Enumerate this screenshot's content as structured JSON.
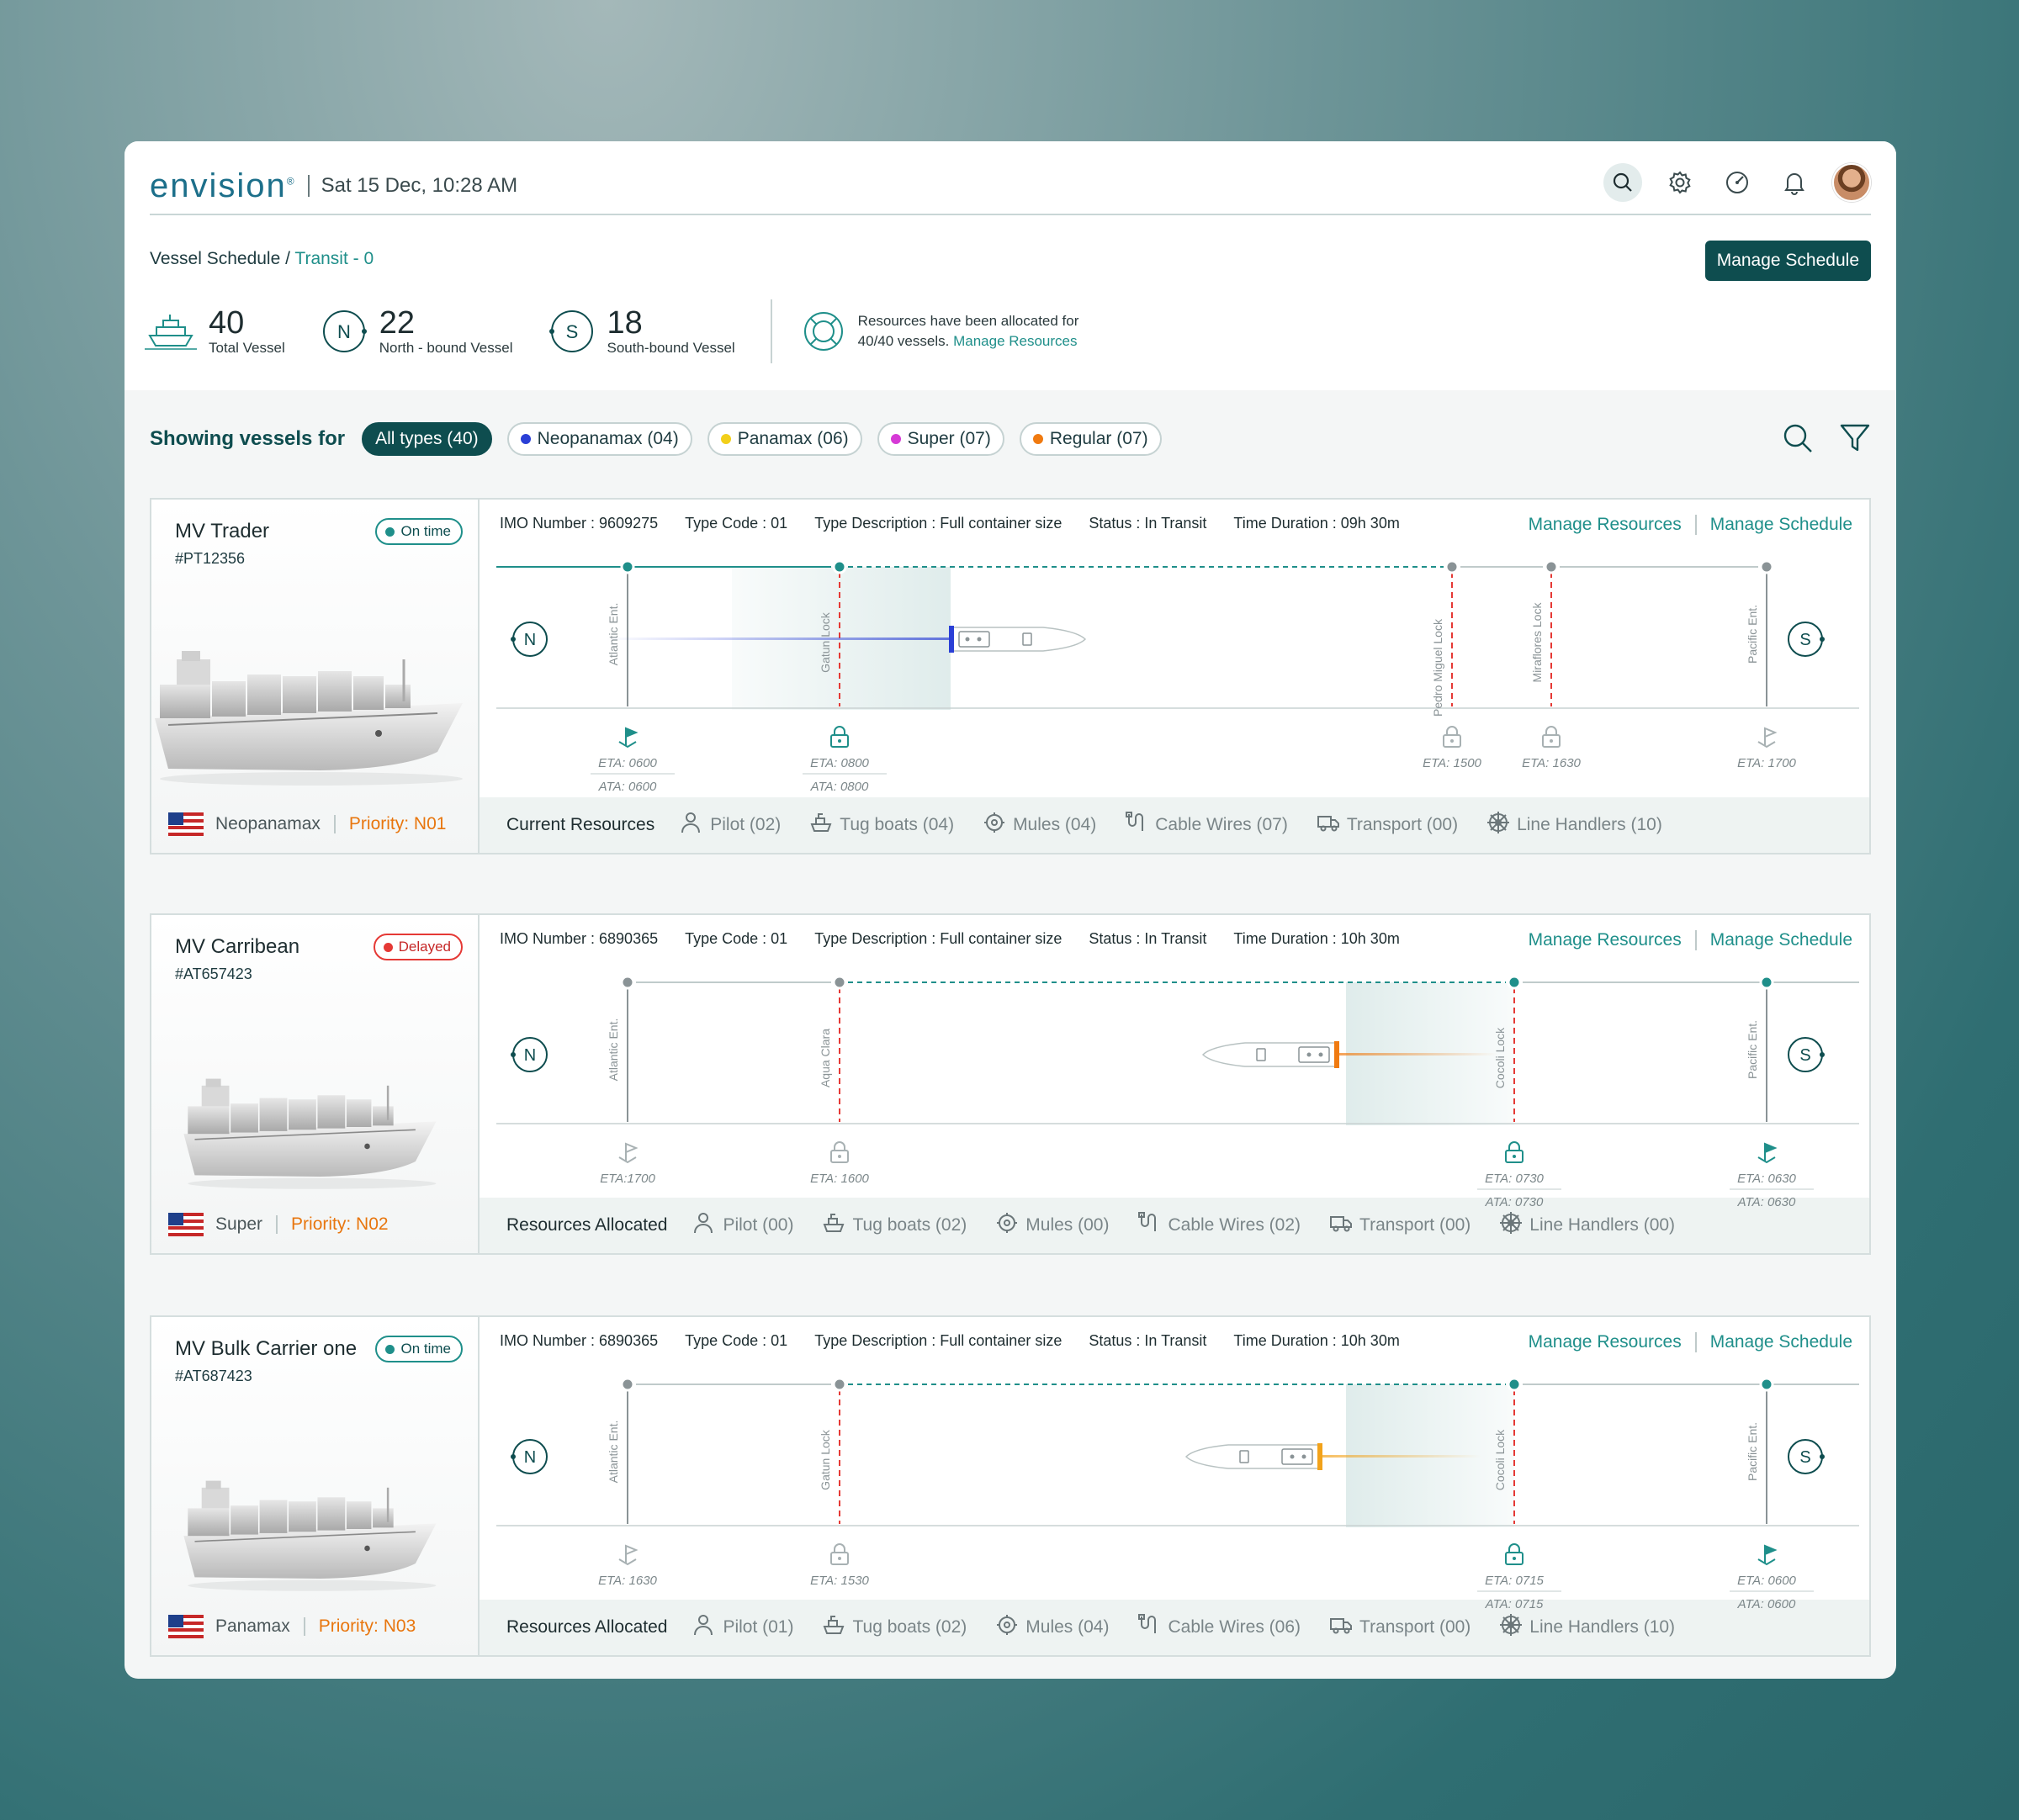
{
  "header": {
    "logo": "envision",
    "datetime": "Sat 15 Dec, 10:28 AM"
  },
  "breadcrumb": {
    "parent": "Vessel Schedule",
    "separator": " / ",
    "current": "Transit - 0"
  },
  "manage_schedule_button": "Manage Schedule",
  "stats": {
    "total": {
      "value": "40",
      "label": "Total Vessel"
    },
    "north": {
      "value": "22",
      "label": "North - bound Vessel",
      "icon_text": "N"
    },
    "south": {
      "value": "18",
      "label": "South-bound Vessel",
      "icon_text": "S"
    },
    "alloc_line1": "Resources have been allocated for",
    "alloc_line2": "40/40 vessels.",
    "alloc_link": "Manage Resources"
  },
  "filters": {
    "label": "Showing vessels for",
    "chips": [
      {
        "label": "All types (40)",
        "color": ""
      },
      {
        "label": "Neopanamax (04)",
        "color": "#2a3fd6"
      },
      {
        "label": "Panamax (06)",
        "color": "#f2cf1a"
      },
      {
        "label": "Super (07)",
        "color": "#d63ad6"
      },
      {
        "label": "Regular (07)",
        "color": "#f07a10"
      }
    ]
  },
  "colors": {
    "primary": "#0e4d4f",
    "accent": "#1f8f8a",
    "ontime": "#1f8f8a",
    "delayed": "#e53935",
    "priority": "#e8760e"
  },
  "vessels": [
    {
      "name": "MV Trader",
      "id": "#PT12356",
      "status": "On time",
      "type": "Neopanamax",
      "priority": "Priority: N01",
      "imo": "IMO Number : 9609275",
      "type_code": "Type Code : 01",
      "type_desc": "Type Description : Full container size",
      "transit_status": "Status : In Transit",
      "duration": "Time Duration : 09h 30m",
      "link_resources": "Manage Resources",
      "link_schedule": "Manage Schedule",
      "res_title": "Current Resources",
      "resources": [
        "Pilot (02)",
        "Tug boats (04)",
        "Mules (04)",
        "Cable Wires (07)",
        "Transport (00)",
        "Line Handlers (10)"
      ],
      "stops": [
        {
          "name": "Atlantic Ent.",
          "eta": "ETA: 0600",
          "ata": "ATA: 0600"
        },
        {
          "name": "Gatun Lock",
          "eta": "ETA: 0800",
          "ata": "ATA: 0800"
        },
        {
          "name": "Pedro Miguel Lock",
          "eta": "ETA: 1500",
          "ata": ""
        },
        {
          "name": "Miraflores Lock",
          "eta": "ETA: 1630",
          "ata": ""
        },
        {
          "name": "Pacific Ent.",
          "eta": "ETA: 1700",
          "ata": ""
        }
      ],
      "start_label": "N",
      "end_label": "S"
    },
    {
      "name": "MV Carribean",
      "id": "#AT657423",
      "status": "Delayed",
      "type": "Super",
      "priority": "Priority: N02",
      "imo": "IMO Number : 6890365",
      "type_code": "Type Code : 01",
      "type_desc": "Type Description : Full container size",
      "transit_status": "Status : In Transit",
      "duration": "Time Duration : 10h 30m",
      "link_resources": "Manage Resources",
      "link_schedule": "Manage Schedule",
      "res_title": "Resources Allocated",
      "resources": [
        "Pilot (00)",
        "Tug boats (02)",
        "Mules (00)",
        "Cable Wires (02)",
        "Transport (00)",
        "Line Handlers (00)"
      ],
      "stops": [
        {
          "name": "Atlantic Ent.",
          "eta": "ETA:1700",
          "ata": ""
        },
        {
          "name": "Aqua Clara",
          "eta": "ETA: 1600",
          "ata": ""
        },
        {
          "name": "Cocoli Lock",
          "eta": "ETA: 0730",
          "ata": "ATA: 0730"
        },
        {
          "name": "Pacific Ent.",
          "eta": "ETA: 0630",
          "ata": "ATA: 0630"
        }
      ],
      "start_label": "N",
      "end_label": "S"
    },
    {
      "name": "MV Bulk Carrier one",
      "id": "#AT687423",
      "status": "On time",
      "type": "Panamax",
      "priority": "Priority: N03",
      "imo": "IMO Number : 6890365",
      "type_code": "Type Code : 01",
      "type_desc": "Type Description : Full container size",
      "transit_status": "Status : In Transit",
      "duration": "Time Duration : 10h 30m",
      "link_resources": "Manage Resources",
      "link_schedule": "Manage Schedule",
      "res_title": "Resources Allocated",
      "resources": [
        "Pilot (01)",
        "Tug boats (02)",
        "Mules (04)",
        "Cable Wires (06)",
        "Transport (00)",
        "Line Handlers (10)"
      ],
      "stops": [
        {
          "name": "Atlantic Ent.",
          "eta": "ETA: 1630",
          "ata": ""
        },
        {
          "name": "Gatun Lock",
          "eta": "ETA: 1530",
          "ata": ""
        },
        {
          "name": "Cocoli Lock",
          "eta": "ETA: 0715",
          "ata": "ATA: 0715"
        },
        {
          "name": "Pacific Ent.",
          "eta": "ETA: 0600",
          "ata": "ATA: 0600"
        }
      ],
      "start_label": "N",
      "end_label": "S"
    }
  ]
}
